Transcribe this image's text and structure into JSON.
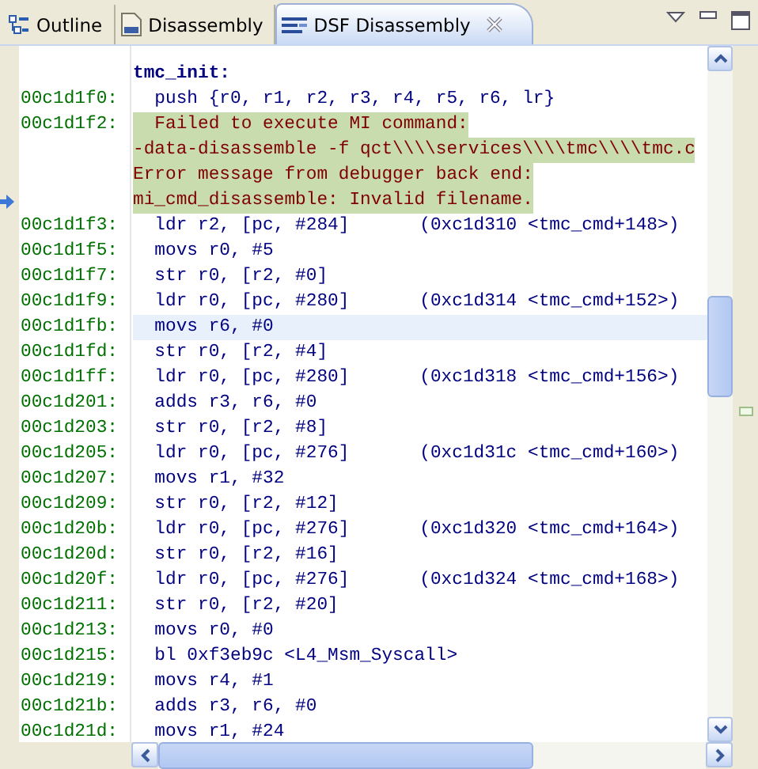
{
  "tabs": [
    {
      "label": "Outline",
      "selected": false
    },
    {
      "label": "Disassembly",
      "selected": false
    },
    {
      "label": "DSF Disassembly",
      "selected": true
    }
  ],
  "rows": [
    {
      "kind": "label",
      "text": "tmc_init:"
    },
    {
      "kind": "instruction",
      "address": "00c1d1f0:",
      "text": "push {r0, r1, r2, r3, r4, r5, r6, lr}",
      "selected": false
    },
    {
      "kind": "error",
      "address": "00c1d1f2:",
      "current": true,
      "lines": [
        "Failed to execute MI command:",
        "-data-disassemble -f qct\\\\\\\\services\\\\\\\\tmc\\\\\\\\tmc.c",
        "Error message from debugger back end:",
        "mi_cmd_disassemble: Invalid filename."
      ]
    },
    {
      "kind": "instruction",
      "address": "00c1d1f3:",
      "text": "ldr r2, [pc, #284]",
      "comment": "(0xc1d310 <tmc_cmd+148>)",
      "selected": false
    },
    {
      "kind": "instruction",
      "address": "00c1d1f5:",
      "text": "movs r0, #5",
      "selected": false
    },
    {
      "kind": "instruction",
      "address": "00c1d1f7:",
      "text": "str r0, [r2, #0]",
      "selected": false
    },
    {
      "kind": "instruction",
      "address": "00c1d1f9:",
      "text": "ldr r0, [pc, #280]",
      "comment": "(0xc1d314 <tmc_cmd+152>)",
      "selected": false
    },
    {
      "kind": "instruction",
      "address": "00c1d1fb:",
      "text": "movs r6, #0",
      "selected": true
    },
    {
      "kind": "instruction",
      "address": "00c1d1fd:",
      "text": "str r0, [r2, #4]",
      "selected": false
    },
    {
      "kind": "instruction",
      "address": "00c1d1ff:",
      "text": "ldr r0, [pc, #280]",
      "comment": "(0xc1d318 <tmc_cmd+156>)",
      "selected": false
    },
    {
      "kind": "instruction",
      "address": "00c1d201:",
      "text": "adds r3, r6, #0",
      "selected": false
    },
    {
      "kind": "instruction",
      "address": "00c1d203:",
      "text": "str r0, [r2, #8]",
      "selected": false
    },
    {
      "kind": "instruction",
      "address": "00c1d205:",
      "text": "ldr r0, [pc, #276]",
      "comment": "(0xc1d31c <tmc_cmd+160>)",
      "selected": false
    },
    {
      "kind": "instruction",
      "address": "00c1d207:",
      "text": "movs r1, #32",
      "selected": false
    },
    {
      "kind": "instruction",
      "address": "00c1d209:",
      "text": "str r0, [r2, #12]",
      "selected": false
    },
    {
      "kind": "instruction",
      "address": "00c1d20b:",
      "text": "ldr r0, [pc, #276]",
      "comment": "(0xc1d320 <tmc_cmd+164>)",
      "selected": false
    },
    {
      "kind": "instruction",
      "address": "00c1d20d:",
      "text": "str r0, [r2, #16]",
      "selected": false
    },
    {
      "kind": "instruction",
      "address": "00c1d20f:",
      "text": "ldr r0, [pc, #276]",
      "comment": "(0xc1d324 <tmc_cmd+168>)",
      "selected": false
    },
    {
      "kind": "instruction",
      "address": "00c1d211:",
      "text": "str r0, [r2, #20]",
      "selected": false
    },
    {
      "kind": "instruction",
      "address": "00c1d213:",
      "text": "movs r0, #0",
      "selected": false
    },
    {
      "kind": "instruction",
      "address": "00c1d215:",
      "text": "bl 0xf3eb9c <L4_Msm_Syscall>",
      "selected": false
    },
    {
      "kind": "instruction",
      "address": "00c1d219:",
      "text": "movs r4, #1",
      "selected": false
    },
    {
      "kind": "instruction",
      "address": "00c1d21b:",
      "text": "adds r3, r6, #0",
      "selected": false
    },
    {
      "kind": "instruction",
      "address": "00c1d21d:",
      "text": "movs r1, #24",
      "selected": false
    }
  ]
}
